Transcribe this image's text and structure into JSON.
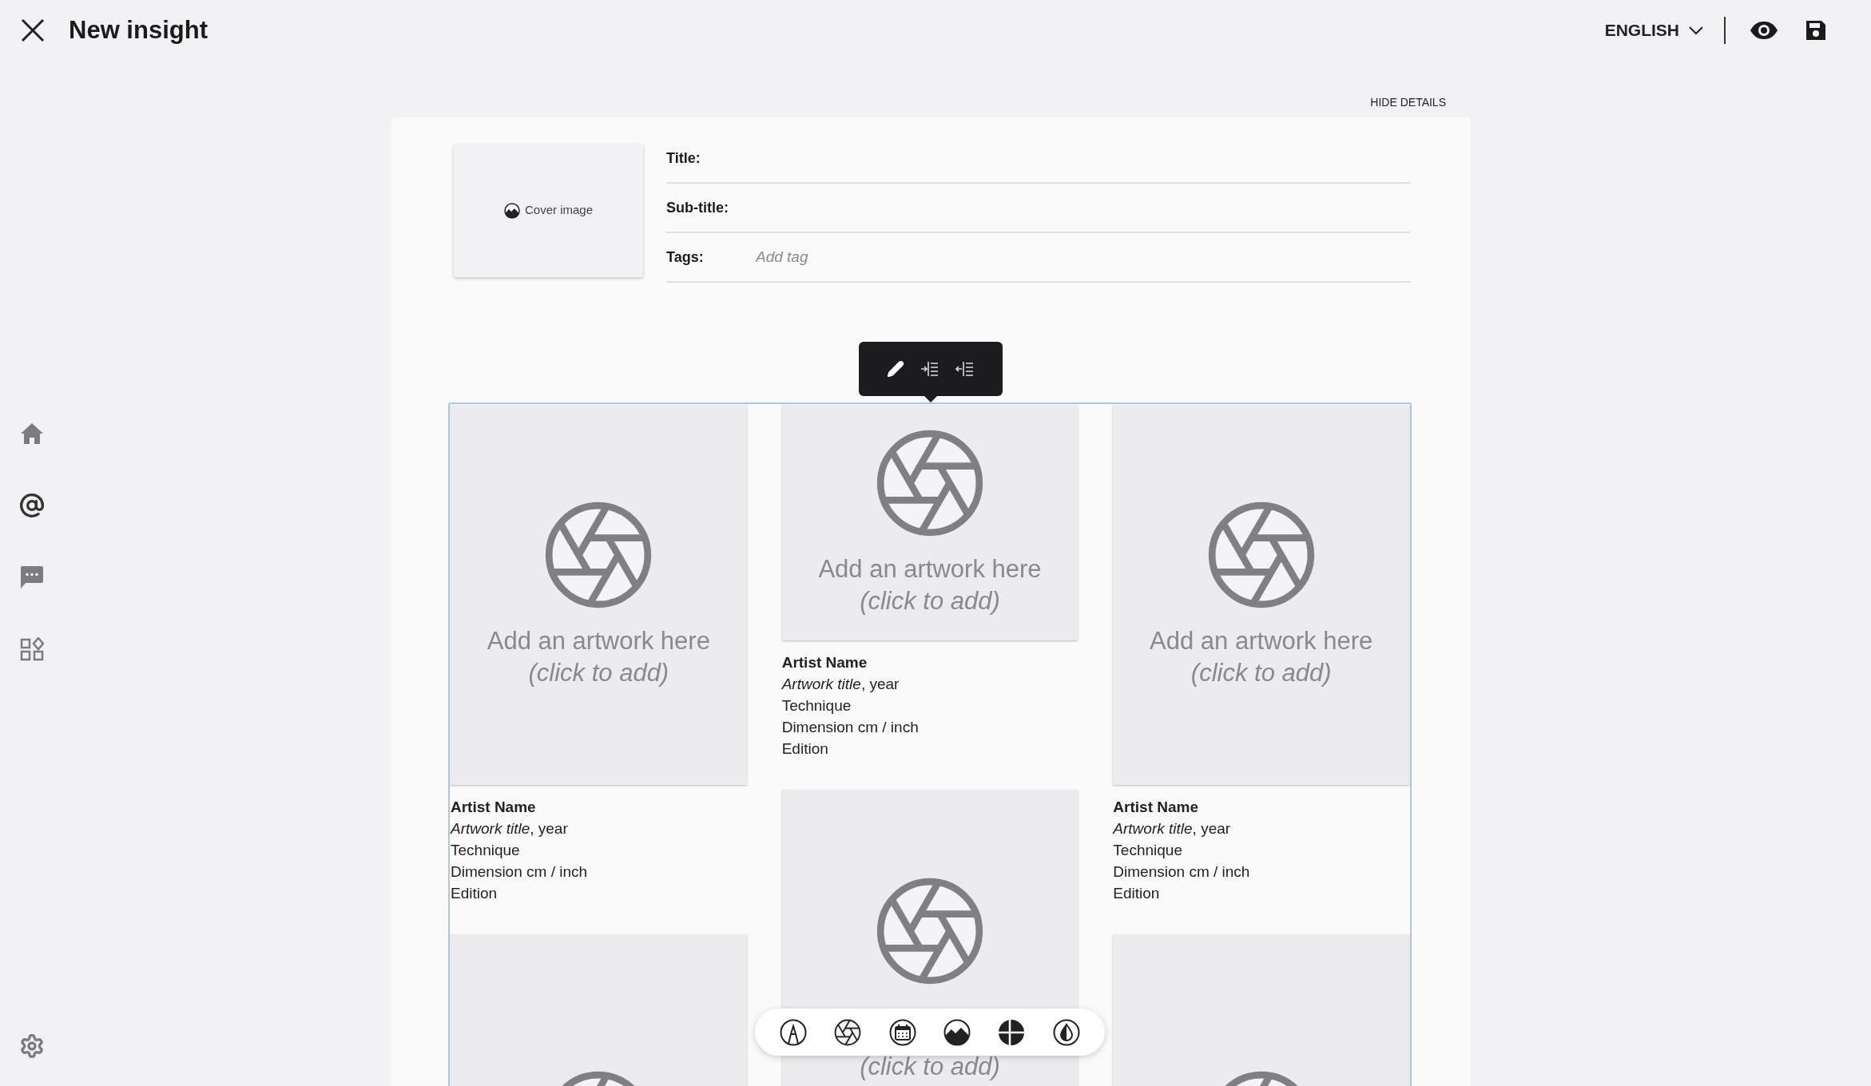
{
  "header": {
    "title": "New insight",
    "language": "ENGLISH"
  },
  "details": {
    "toggle": "HIDE DETAILS",
    "cover": "Cover image",
    "fields": [
      {
        "label": "Title:"
      },
      {
        "label": "Sub-title:"
      },
      {
        "label": "Tags:",
        "placeholder": "Add tag"
      }
    ]
  },
  "grid": {
    "columns": [
      {
        "tiles": [
          {
            "kind": "portrait",
            "prompt": "Add an artwork here",
            "hint": "(click to add)",
            "caption": {
              "artist": "Artist Name",
              "title": "*Artwork title*, year",
              "lines": [
                "Technique",
                "Dimension cm / inch",
                "Edition"
              ]
            }
          },
          {
            "kind": "portrait"
          }
        ]
      },
      {
        "tiles": [
          {
            "kind": "landscape",
            "prompt": "Add an artwork here",
            "hint": "(click to add)",
            "caption": {
              "artist": "Artist Name",
              "title": "*Artwork title*, year",
              "lines": [
                "Technique",
                "Dimension cm / inch",
                "Edition"
              ]
            }
          },
          {
            "kind": "portrait",
            "hint": "(click to add)"
          }
        ]
      },
      {
        "tiles": [
          {
            "kind": "portrait",
            "prompt": "Add an artwork here",
            "hint": "(click to add)",
            "caption": {
              "artist": "Artist Name",
              "title": "*Artwork title*, year",
              "lines": [
                "Technique",
                "Dimension cm / inch",
                "Edition"
              ]
            }
          },
          {
            "kind": "portrait"
          }
        ]
      }
    ]
  }
}
